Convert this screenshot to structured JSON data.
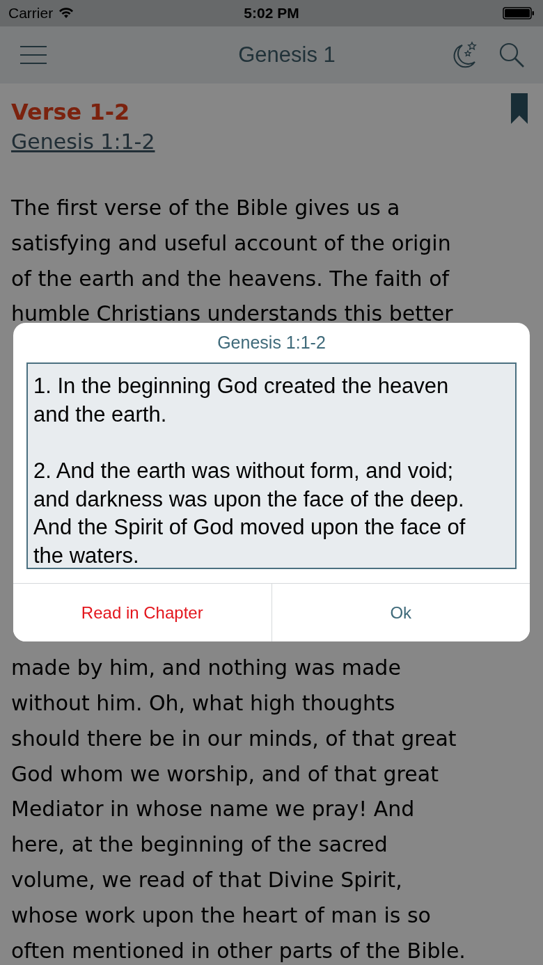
{
  "status_bar": {
    "carrier": "Carrier",
    "time": "5:02 PM"
  },
  "nav_bar": {
    "title": "Genesis 1"
  },
  "article": {
    "heading": "Verse 1-2",
    "reference": "Genesis 1:1-2",
    "text_above": [
      "The first verse of the Bible gives us a",
      "satisfying and useful account of the origin",
      "of the earth and the heavens. The faith of",
      "humble Christians understands this better"
    ],
    "text_below": [
      "made by him, and nothing was made",
      "without him. Oh, what high thoughts",
      "should there be in our minds, of that great",
      "God whom we worship, and of that great",
      "Mediator in whose name we pray! And",
      "here, at the beginning of the sacred",
      "volume, we read of that Divine Spirit,",
      "whose work upon the heart of man is so",
      "often mentioned in other parts of the Bible."
    ]
  },
  "dialog": {
    "title": "Genesis 1:1-2",
    "verses": [
      "1. In the beginning God created the heaven and the earth.",
      "2. And the earth was without form, and void; and darkness was upon the face of the deep. And the Spirit of God moved upon the face of the waters."
    ],
    "buttons": [
      {
        "label": "Read in Chapter",
        "kind": "destructive"
      },
      {
        "label": "Ok",
        "kind": "default"
      }
    ]
  }
}
